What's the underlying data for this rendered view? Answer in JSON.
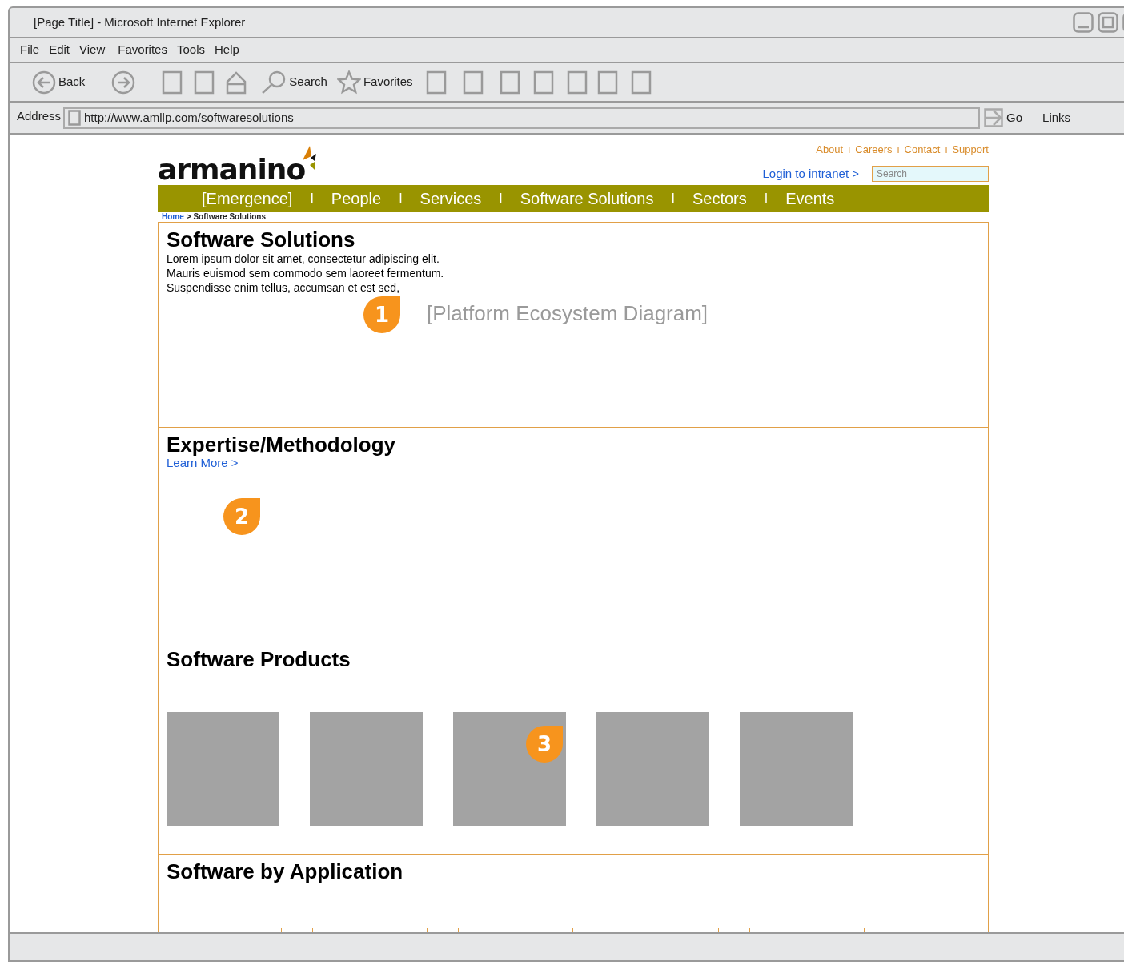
{
  "window": {
    "title": "[Page Title] - Microsoft Internet Explorer"
  },
  "menu": [
    "File",
    "Edit",
    "View",
    "Favorites",
    "Tools",
    "Help"
  ],
  "toolbar": [
    {
      "kind": "back",
      "label": "Back"
    },
    {
      "kind": "forward"
    },
    {
      "kind": "blank"
    },
    {
      "kind": "blank"
    },
    {
      "kind": "home"
    },
    {
      "kind": "search",
      "label": "Search"
    },
    {
      "kind": "favorites",
      "label": "Favorites"
    },
    {
      "kind": "blank"
    },
    {
      "kind": "blank"
    },
    {
      "kind": "blank"
    },
    {
      "kind": "blank"
    },
    {
      "kind": "blank"
    },
    {
      "kind": "blank"
    },
    {
      "kind": "blank"
    }
  ],
  "address_bar": {
    "label": "Address",
    "url": "http://www.amllp.com/softwaresolutions",
    "go": "Go",
    "links": "Links"
  },
  "site": {
    "logo": "armanino",
    "utility_links": [
      "About",
      "Careers",
      "Contact",
      "Support"
    ],
    "utility_separators": [
      "I",
      "I",
      "I"
    ],
    "login_link": "Login to intranet >",
    "search": {
      "placeholder": "Search"
    },
    "nav": [
      "[Emergence]",
      "People",
      "Services",
      "Software Solutions",
      "Sectors",
      "Events"
    ],
    "nav_separators": [
      "I",
      "I",
      "I",
      "I",
      "I"
    ],
    "breadcrumb": {
      "home": "Home",
      "current": "> Software Solutions"
    },
    "sections": [
      {
        "kind": "intro",
        "title": "Software Solutions",
        "lines": [
          "Lorem ipsum dolor sit amet, consectetur adipiscing elit.",
          "Mauris euismod sem commodo sem laoreet fermentum.",
          "Suspendisse enim tellus, accumsan et est sed,"
        ],
        "placeholder": "[Platform Ecosystem Diagram]",
        "marker": "1"
      },
      {
        "kind": "link",
        "title": "Expertise/Methodology",
        "link": "Learn More >",
        "marker": "2"
      },
      {
        "kind": "tiles",
        "title": "Software Products",
        "tiles": [
          {
            "kind": "image"
          },
          {
            "kind": "image"
          },
          {
            "kind": "image"
          },
          {
            "kind": "image"
          },
          {
            "kind": "image"
          }
        ],
        "marker": "3"
      },
      {
        "kind": "tiles",
        "title": "Software by Application",
        "tiles": [
          {
            "kind": "card"
          },
          {
            "kind": "card"
          },
          {
            "kind": "card"
          },
          {
            "kind": "card"
          },
          {
            "kind": "card"
          }
        ]
      }
    ]
  }
}
